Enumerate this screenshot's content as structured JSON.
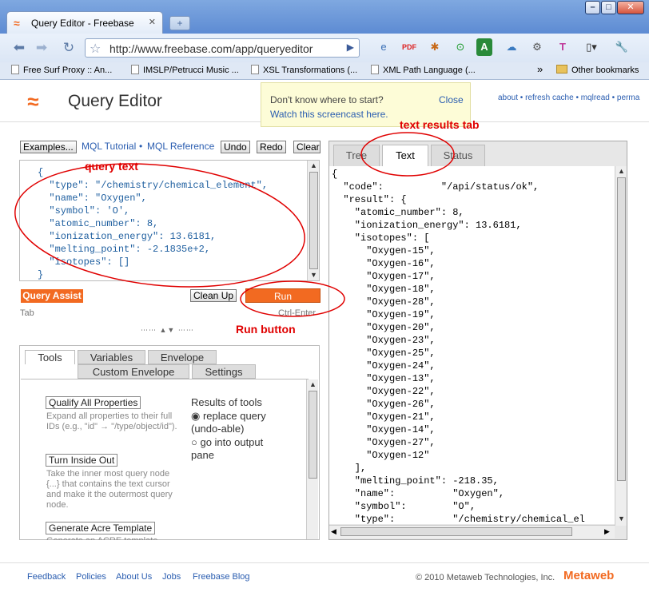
{
  "browser": {
    "tab_title": "Query Editor - Freebase",
    "url": "http://www.freebase.com/app/queryeditor",
    "bookmarks": [
      "Free Surf Proxy :: An...",
      "IMSLP/Petrucci Music ...",
      "XSL Transformations (...",
      "XML Path Language (..."
    ],
    "other_bookmarks": "Other bookmarks",
    "window_buttons": [
      "–",
      "□",
      "✕"
    ]
  },
  "header": {
    "logo": "≈",
    "title": "Query Editor",
    "tooltip_line1": "Don't know where to start?",
    "tooltip_line2": "Watch this screencast here.",
    "tooltip_close": "Close",
    "links": "about • refresh cache • mqlread • perma"
  },
  "query_toolbar": {
    "examples": "Examples...",
    "mql_tutorial": "MQL Tutorial",
    "separator": "•",
    "mql_reference": "MQL Reference",
    "undo": "Undo",
    "redo": "Redo",
    "clear": "Clear"
  },
  "query": {
    "text": "{\n  \"type\": \"/chemistry/chemical_element\",\n  \"name\": \"Oxygen\",\n  \"symbol\": 'O',\n  \"atomic_number\": 8,\n  \"ionization_energy\": 13.6181,\n  \"melting_point\": -2.1835e+2,\n  \"isotopes\": []\n}"
  },
  "actions": {
    "query_assist": "Query Assist",
    "clean_up": "Clean Up",
    "run": "Run",
    "tab_hint": "Tab",
    "run_hint": "Ctrl-Enter",
    "splitter": "⋯⋯ ▲▼ ⋯⋯"
  },
  "tools_panel": {
    "tabs": [
      "Tools",
      "Variables",
      "Envelope",
      "Custom Envelope",
      "Settings"
    ],
    "tools": [
      {
        "name": "Qualify All Properties",
        "desc": "Expand all properties to their full IDs (e.g., \"id\" → \"/type/object/id\")."
      },
      {
        "name": "Turn Inside Out",
        "desc": "Take the inner most query node {...} that contains the text cursor and make it the outermost query node."
      },
      {
        "name": "Generate Acre Template",
        "desc": "Generate an ACRE template"
      }
    ],
    "results_heading": "Results of tools",
    "option_replace": "replace query (undo-able)",
    "option_output": "go into output pane"
  },
  "results": {
    "tabs": [
      "Tree",
      "Text",
      "Status"
    ],
    "text": "{\n  \"code\":          \"/api/status/ok\",\n  \"result\": {\n    \"atomic_number\": 8,\n    \"ionization_energy\": 13.6181,\n    \"isotopes\": [\n      \"Oxygen-15\",\n      \"Oxygen-16\",\n      \"Oxygen-17\",\n      \"Oxygen-18\",\n      \"Oxygen-28\",\n      \"Oxygen-19\",\n      \"Oxygen-20\",\n      \"Oxygen-23\",\n      \"Oxygen-25\",\n      \"Oxygen-24\",\n      \"Oxygen-13\",\n      \"Oxygen-22\",\n      \"Oxygen-26\",\n      \"Oxygen-21\",\n      \"Oxygen-14\",\n      \"Oxygen-27\",\n      \"Oxygen-12\"\n    ],\n    \"melting_point\": -218.35,\n    \"name\":          \"Oxygen\",\n    \"symbol\":        \"O\",\n    \"type\":          \"/chemistry/chemical_el"
  },
  "annotations": {
    "query_text": "query text",
    "text_results_tab": "text results tab",
    "run_button": "Run button"
  },
  "footer": {
    "links": [
      "Feedback",
      "Policies",
      "About Us",
      "Jobs",
      "Freebase Blog"
    ],
    "copyright": "© 2010 Metaweb Technologies, Inc.",
    "brand": "Metaweb"
  },
  "colors": {
    "accent": "#f26a21",
    "link": "#2a5db0",
    "annotation": "#e00000"
  }
}
